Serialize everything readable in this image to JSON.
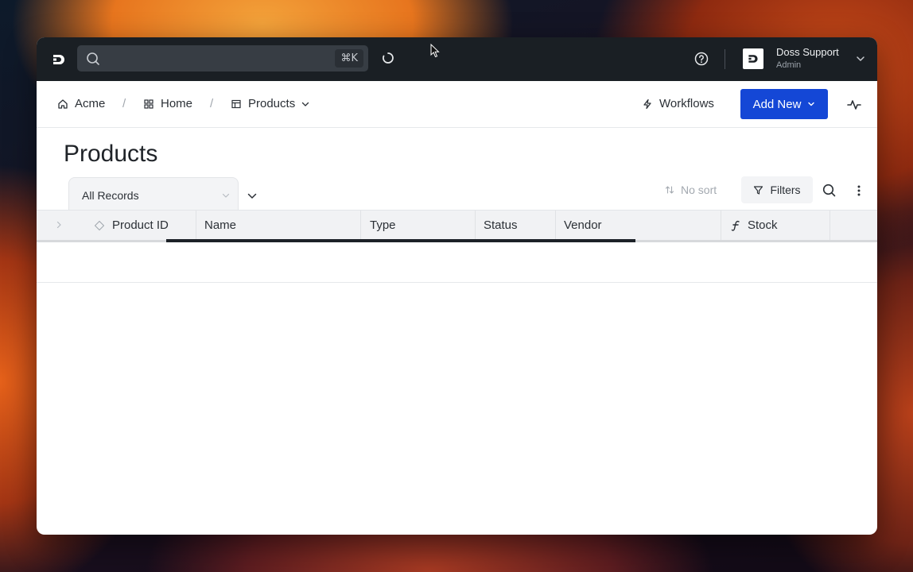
{
  "topbar": {
    "search": {
      "placeholder": "",
      "shortcut": "⌘K"
    },
    "user": {
      "name": "Doss Support",
      "role": "Admin"
    }
  },
  "breadcrumb": {
    "items": [
      {
        "label": "Acme",
        "icon": "home-icon"
      },
      {
        "label": "Home",
        "icon": "grid-icon"
      },
      {
        "label": "Products",
        "icon": "table-icon"
      }
    ],
    "separator": "/"
  },
  "actions": {
    "workflows": "Workflows",
    "add_new": "Add New"
  },
  "page": {
    "title": "Products"
  },
  "view": {
    "selected": "All Records"
  },
  "toolbar": {
    "sort": "No sort",
    "filters": "Filters"
  },
  "table": {
    "columns": [
      {
        "label": "Product ID",
        "icon": "diamond-icon"
      },
      {
        "label": "Name"
      },
      {
        "label": "Type"
      },
      {
        "label": "Status"
      },
      {
        "label": "Vendor"
      },
      {
        "label": "Stock",
        "icon": "function-icon"
      }
    ],
    "rows": []
  },
  "colors": {
    "accent": "#1447d6",
    "topbar": "#1a1f24"
  }
}
